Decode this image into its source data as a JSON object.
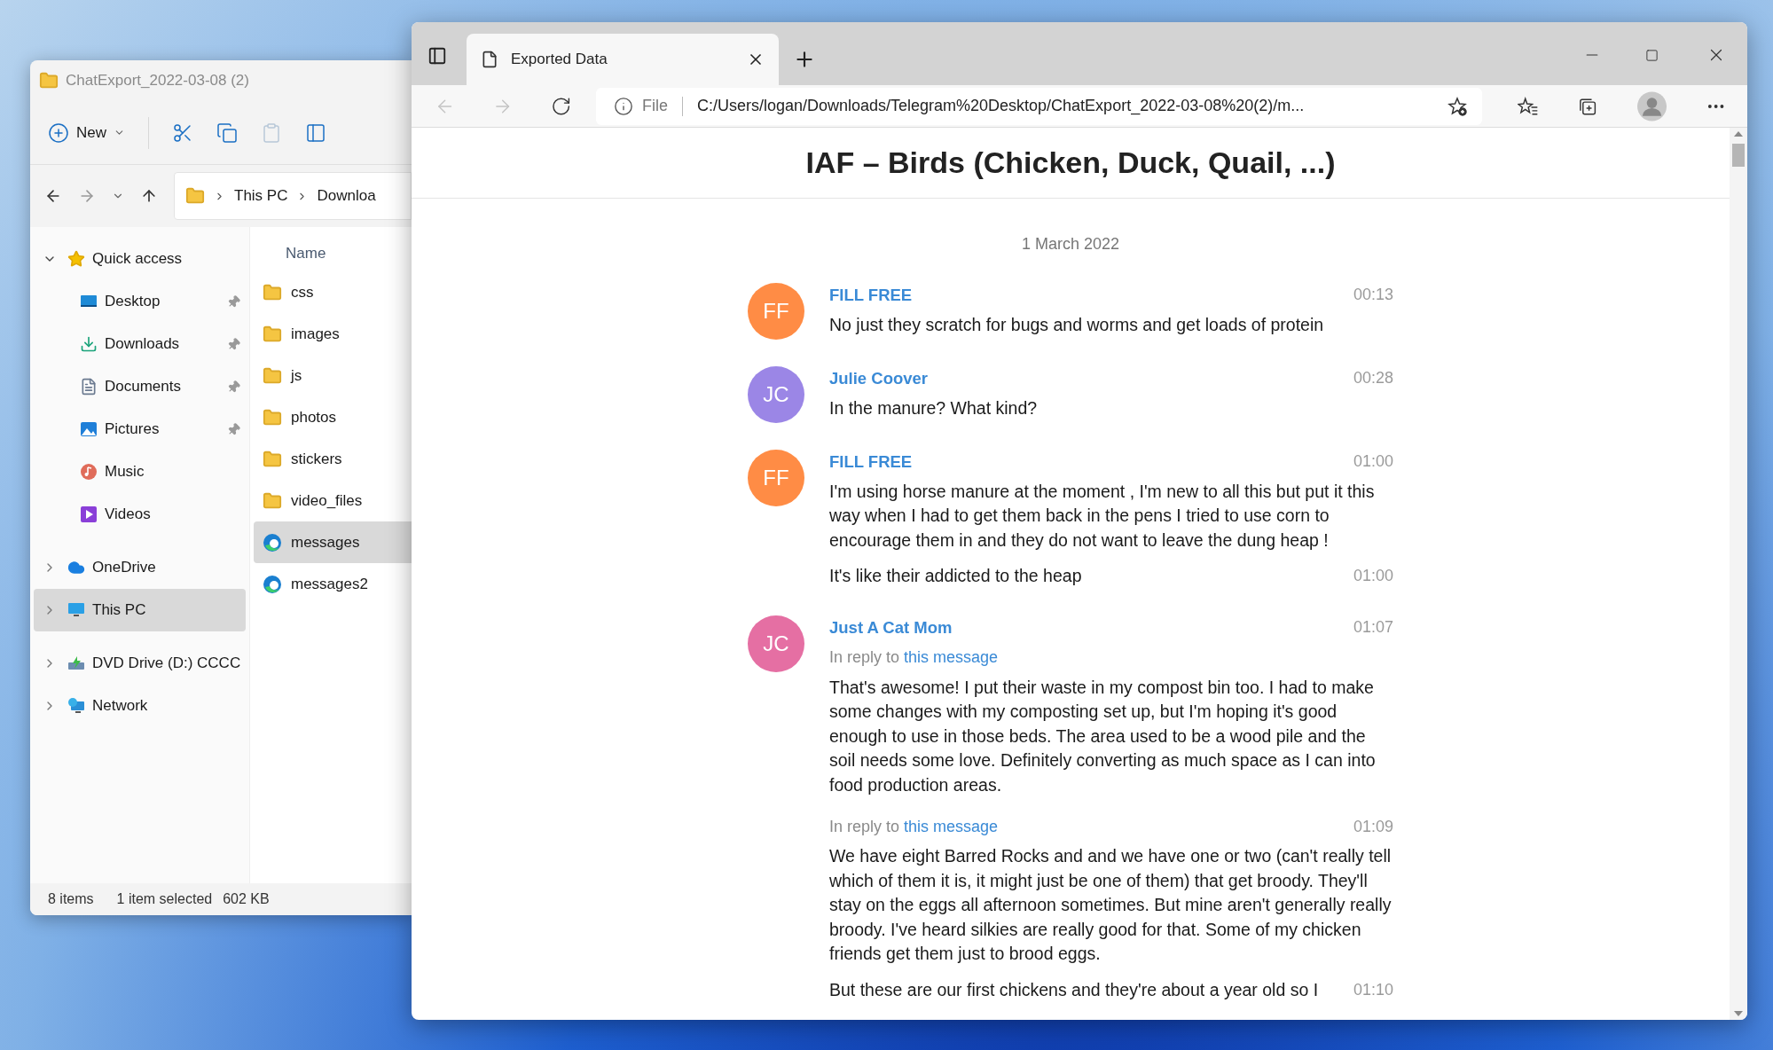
{
  "explorer": {
    "title": "ChatExport_2022-03-08 (2)",
    "toolbar": {
      "new_label": "New",
      "paste_disabled": true
    },
    "nav_buttons": {
      "back_disabled": false,
      "forward_disabled": true
    },
    "breadcrumb": [
      "This PC",
      "Downloa"
    ],
    "nav": [
      {
        "label": "Quick access",
        "kind": "star",
        "expanded": true,
        "selected": false,
        "children": [
          {
            "label": "Desktop",
            "kind": "desktop",
            "pinned": true,
            "selected": false
          },
          {
            "label": "Downloads",
            "kind": "downloads",
            "pinned": true,
            "selected": false
          },
          {
            "label": "Documents",
            "kind": "documents",
            "pinned": true,
            "selected": false
          },
          {
            "label": "Pictures",
            "kind": "pictures",
            "pinned": true,
            "selected": false
          },
          {
            "label": "Music",
            "kind": "music",
            "pinned": false,
            "selected": false
          },
          {
            "label": "Videos",
            "kind": "videos",
            "pinned": false,
            "selected": false
          }
        ]
      },
      {
        "label": "OneDrive",
        "kind": "cloud",
        "expanded": false,
        "selected": false
      },
      {
        "label": "This PC",
        "kind": "pc",
        "expanded": false,
        "selected": true
      },
      {
        "label": "DVD Drive (D:) CCCC",
        "kind": "dvd",
        "expanded": false,
        "selected": false
      },
      {
        "label": "Network",
        "kind": "network",
        "expanded": false,
        "selected": false
      }
    ],
    "column": "Name",
    "files": [
      {
        "name": "css",
        "kind": "folder",
        "selected": false
      },
      {
        "name": "images",
        "kind": "folder",
        "selected": false
      },
      {
        "name": "js",
        "kind": "folder",
        "selected": false
      },
      {
        "name": "photos",
        "kind": "folder",
        "selected": false
      },
      {
        "name": "stickers",
        "kind": "folder",
        "selected": false
      },
      {
        "name": "video_files",
        "kind": "folder",
        "selected": false
      },
      {
        "name": "messages",
        "kind": "html",
        "selected": true
      },
      {
        "name": "messages2",
        "kind": "html",
        "selected": false
      }
    ],
    "status": {
      "count": "8 items",
      "selection": "1 item selected",
      "size": "602 KB"
    }
  },
  "browser": {
    "tabs": [
      {
        "title": "Exported Data",
        "selected": true
      }
    ],
    "back_disabled": true,
    "forward_disabled": true,
    "address": {
      "scheme": "File",
      "url": "C:/Users/logan/Downloads/Telegram%20Desktop/ChatExport_2022-03-08%20(2)/m..."
    },
    "page": {
      "title": "IAF – Birds (Chicken, Duck, Quail, ...)",
      "date": "1 March 2022",
      "groups": [
        {
          "initials": "FF",
          "color": "#ff8c45",
          "sender": "FILL FREE",
          "parts": [
            {
              "time": "00:13",
              "text": "No just they scratch for bugs and worms and get loads of protein"
            }
          ]
        },
        {
          "initials": "JC",
          "color": "#9b86e6",
          "sender": "Julie Coover",
          "parts": [
            {
              "time": "00:28",
              "text": "In the manure? What kind?"
            }
          ]
        },
        {
          "initials": "FF",
          "color": "#ff8c45",
          "sender": "FILL FREE",
          "parts": [
            {
              "time": "01:00",
              "text": "I'm using horse manure at the moment , I'm new to all this but put it this way when I had to get them back in the pens I tried to use corn to encourage them in and they do not want to leave the dung heap !"
            },
            {
              "time": "01:00",
              "text": "It's like their addicted to the heap"
            }
          ]
        },
        {
          "initials": "JC",
          "color": "#e56fa3",
          "sender": "Just A Cat Mom",
          "parts": [
            {
              "time": "01:07",
              "reply": "In reply to",
              "reply_link": "this message",
              "text": "That's awesome! I put their waste in my compost bin too. I had to make some changes with my composting set up, but I'm hoping it's good enough to use in those beds. The area used to be a wood pile and the soil needs some love. Definitely converting as much space as I can into food production areas."
            },
            {
              "time": "01:09",
              "reply": "In reply to",
              "reply_link": "this message",
              "text": "We have eight Barred Rocks and and we have one or two (can't really tell which of them it is, it might just be one of them) that get broody. They'll stay on the eggs all afternoon sometimes. But mine aren't generally really broody. I've heard silkies are really good for that. Some of my chicken friends get them just to brood eggs."
            },
            {
              "time": "01:10",
              "text": "But these are our first chickens and they're about a year old so I"
            }
          ]
        }
      ]
    }
  }
}
